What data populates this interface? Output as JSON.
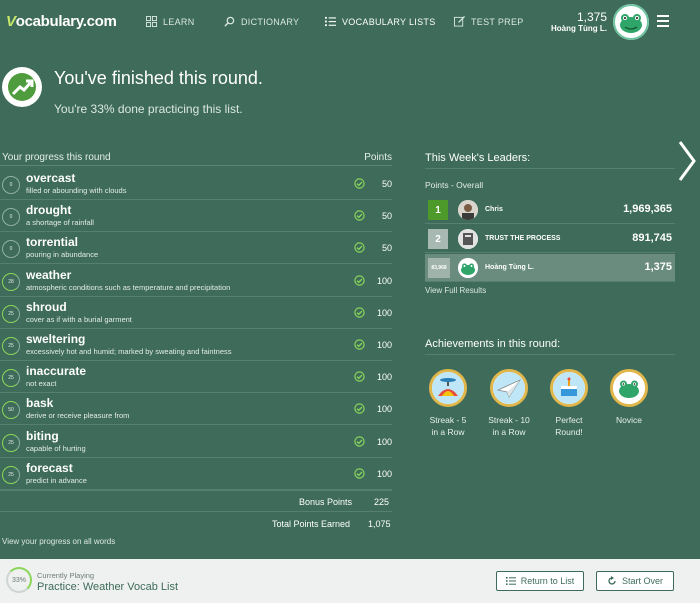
{
  "nav": {
    "logo": "ocabulary.com",
    "logo_v": "V",
    "items": [
      {
        "label": "LEARN",
        "icon": "grid-icon"
      },
      {
        "label": "DICTIONARY",
        "icon": "search-icon"
      },
      {
        "label": "VOCABULARY LISTS",
        "icon": "list-icon"
      },
      {
        "label": "TEST PREP",
        "icon": "edit-icon"
      }
    ],
    "active": "VOCABULARY LISTS",
    "user_points": "1,375",
    "user_name": "Hoàng Tùng L."
  },
  "banner": {
    "title": "You've finished this round.",
    "subtitle": "You're 33% done practicing this list."
  },
  "progress": {
    "header": "Your progress this round",
    "points_header": "Points",
    "words": [
      {
        "ring": "0",
        "word": "overcast",
        "definition": "filled or abounding with clouds",
        "points": "50"
      },
      {
        "ring": "0",
        "word": "drought",
        "definition": "a shortage of rainfall",
        "points": "50"
      },
      {
        "ring": "0",
        "word": "torrential",
        "definition": "pouring in abundance",
        "points": "50"
      },
      {
        "ring": "28",
        "word": "weather",
        "definition": "atmospheric conditions such as temperature and precipitation",
        "points": "100"
      },
      {
        "ring": "25",
        "word": "shroud",
        "definition": "cover as if with a burial garment",
        "points": "100"
      },
      {
        "ring": "25",
        "word": "sweltering",
        "definition": "excessively hot and humid; marked by sweating and faintness",
        "points": "100"
      },
      {
        "ring": "25",
        "word": "inaccurate",
        "definition": "not exact",
        "points": "100"
      },
      {
        "ring": "50",
        "word": "bask",
        "definition": "derive or receive pleasure from",
        "points": "100"
      },
      {
        "ring": "25",
        "word": "biting",
        "definition": "capable of hurting",
        "points": "100"
      },
      {
        "ring": "25",
        "word": "forecast",
        "definition": "predict in advance",
        "points": "100"
      }
    ],
    "bonus_label": "Bonus Points",
    "bonus_value": "225",
    "total_label": "Total Points Earned",
    "total_value": "1,075",
    "view_all": "View your progress on all words"
  },
  "leaders": {
    "title": "This Week's Leaders:",
    "subtitle": "Points - Overall",
    "rows": [
      {
        "rank": "1",
        "name": "Chris",
        "points": "1,969,365"
      },
      {
        "rank": "2",
        "name": "TRUST THE PROCESS",
        "points": "891,745"
      },
      {
        "rank": "83,968",
        "name": "Hoàng Tùng L.",
        "points": "1,375"
      }
    ],
    "full_results": "View Full Results"
  },
  "achievements": {
    "title": "Achievements in this round:",
    "items": [
      {
        "label1": "Streak - 5",
        "label2": "in a Row",
        "icon": "propeller-hat-icon"
      },
      {
        "label1": "Streak - 10",
        "label2": "in a Row",
        "icon": "paper-plane-icon"
      },
      {
        "label1": "Perfect",
        "label2": "Round!",
        "icon": "cake-icon"
      },
      {
        "label1": "Novice",
        "label2": "",
        "icon": "frog-icon"
      }
    ]
  },
  "footer": {
    "ring": "33%",
    "label": "Currently Playing",
    "list_name": "Practice: Weather Vocab List",
    "return_label": "Return to List",
    "start_over_label": "Start Over"
  },
  "colors": {
    "background": "#3e6b5a",
    "accent_green": "#8bd65b",
    "rank1": "#4d9a2a",
    "badge_ring": "#e1b64a",
    "footer_bg": "#eef1ef"
  }
}
